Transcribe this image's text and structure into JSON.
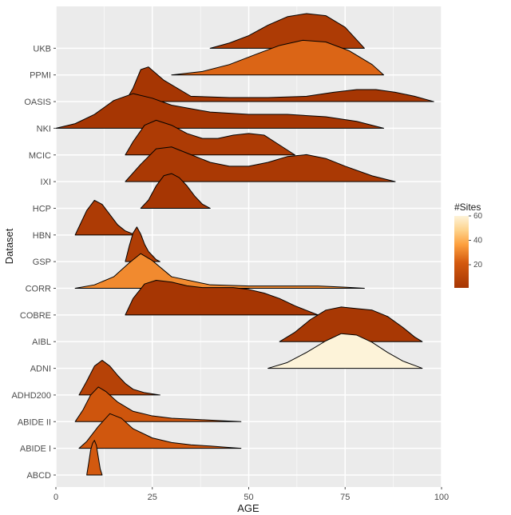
{
  "chart_data": {
    "type": "ridgeline",
    "xlabel": "AGE",
    "ylabel": "Dataset",
    "xlim": [
      0,
      100
    ],
    "x_ticks": [
      0,
      25,
      50,
      75,
      100
    ],
    "legend": {
      "title": "#Sites",
      "min": 1,
      "max": 60,
      "ticks": [
        20,
        40,
        60
      ],
      "low_color": "#a63603",
      "high_color": "#fdf3d9"
    },
    "categories": [
      "UKB",
      "PPMI",
      "OASIS",
      "NKI",
      "MCIC",
      "IXI",
      "HCP",
      "HBN",
      "GSP",
      "CORR",
      "COBRE",
      "AIBL",
      "ADNI",
      "ADHD200",
      "ABIDE II",
      "ABIDE I",
      "ABCD"
    ],
    "series": [
      {
        "name": "UKB",
        "sites": 4,
        "age_range": [
          40,
          80
        ],
        "peak_age": 65,
        "shape": "unimodal-broad",
        "density": [
          [
            40,
            0
          ],
          [
            45,
            5
          ],
          [
            50,
            12
          ],
          [
            55,
            22
          ],
          [
            60,
            30
          ],
          [
            65,
            33
          ],
          [
            70,
            31
          ],
          [
            75,
            20
          ],
          [
            80,
            0
          ]
        ]
      },
      {
        "name": "PPMI",
        "sites": 24,
        "age_range": [
          30,
          85
        ],
        "peak_age": 65,
        "shape": "unimodal-broad-right",
        "density": [
          [
            30,
            0
          ],
          [
            38,
            2
          ],
          [
            45,
            6
          ],
          [
            52,
            12
          ],
          [
            58,
            17
          ],
          [
            64,
            20
          ],
          [
            70,
            19
          ],
          [
            76,
            14
          ],
          [
            82,
            6
          ],
          [
            85,
            0
          ]
        ]
      },
      {
        "name": "OASIS",
        "sites": 1,
        "age_range": [
          18,
          98
        ],
        "peak_age": 23,
        "shape": "bimodal",
        "density": [
          [
            18,
            0
          ],
          [
            20,
            10
          ],
          [
            22,
            24
          ],
          [
            24,
            26
          ],
          [
            28,
            16
          ],
          [
            35,
            4
          ],
          [
            45,
            3
          ],
          [
            55,
            3
          ],
          [
            65,
            4
          ],
          [
            72,
            7
          ],
          [
            78,
            9
          ],
          [
            83,
            9
          ],
          [
            88,
            7
          ],
          [
            93,
            4
          ],
          [
            98,
            0
          ]
        ]
      },
      {
        "name": "NKI",
        "sites": 1,
        "age_range": [
          0,
          85
        ],
        "peak_age": 20,
        "shape": "unimodal-very-wide",
        "density": [
          [
            0,
            0
          ],
          [
            5,
            2
          ],
          [
            10,
            6
          ],
          [
            15,
            12
          ],
          [
            20,
            15
          ],
          [
            25,
            13
          ],
          [
            30,
            10
          ],
          [
            40,
            7
          ],
          [
            50,
            6
          ],
          [
            60,
            6
          ],
          [
            70,
            5
          ],
          [
            78,
            3
          ],
          [
            85,
            0
          ]
        ]
      },
      {
        "name": "MCIC",
        "sites": 4,
        "age_range": [
          18,
          62
        ],
        "peak_age": 25,
        "shape": "bimodal-soft",
        "density": [
          [
            18,
            0
          ],
          [
            20,
            8
          ],
          [
            23,
            18
          ],
          [
            26,
            21
          ],
          [
            30,
            18
          ],
          [
            34,
            13
          ],
          [
            38,
            10
          ],
          [
            42,
            10
          ],
          [
            46,
            12
          ],
          [
            50,
            13
          ],
          [
            54,
            12
          ],
          [
            58,
            6
          ],
          [
            62,
            0
          ]
        ]
      },
      {
        "name": "IXI",
        "sites": 3,
        "age_range": [
          18,
          88
        ],
        "peak_age": 28,
        "shape": "bimodal",
        "density": [
          [
            18,
            0
          ],
          [
            22,
            9
          ],
          [
            26,
            17
          ],
          [
            30,
            18
          ],
          [
            35,
            14
          ],
          [
            40,
            10
          ],
          [
            45,
            8
          ],
          [
            50,
            8
          ],
          [
            55,
            10
          ],
          [
            60,
            13
          ],
          [
            65,
            14
          ],
          [
            70,
            12
          ],
          [
            75,
            8
          ],
          [
            82,
            3
          ],
          [
            88,
            0
          ]
        ]
      },
      {
        "name": "HCP",
        "sites": 1,
        "age_range": [
          22,
          40
        ],
        "peak_age": 29,
        "shape": "unimodal-narrow",
        "density": [
          [
            22,
            0
          ],
          [
            24,
            8
          ],
          [
            26,
            22
          ],
          [
            28,
            32
          ],
          [
            30,
            34
          ],
          [
            32,
            30
          ],
          [
            34,
            22
          ],
          [
            36,
            12
          ],
          [
            38,
            4
          ],
          [
            40,
            0
          ]
        ]
      },
      {
        "name": "HBN",
        "sites": 4,
        "age_range": [
          5,
          22
        ],
        "peak_age": 10,
        "shape": "unimodal-narrow",
        "density": [
          [
            5,
            0
          ],
          [
            6,
            8
          ],
          [
            8,
            24
          ],
          [
            10,
            34
          ],
          [
            12,
            30
          ],
          [
            14,
            20
          ],
          [
            16,
            10
          ],
          [
            18,
            4
          ],
          [
            20,
            1
          ],
          [
            22,
            0
          ]
        ]
      },
      {
        "name": "GSP",
        "sites": 5,
        "age_range": [
          18,
          27
        ],
        "peak_age": 21,
        "shape": "unimodal-sharp",
        "density": [
          [
            18,
            0
          ],
          [
            19,
            15
          ],
          [
            20,
            28
          ],
          [
            21,
            34
          ],
          [
            22,
            27
          ],
          [
            23,
            17
          ],
          [
            24,
            10
          ],
          [
            25,
            6
          ],
          [
            26,
            2
          ],
          [
            27,
            0
          ]
        ]
      },
      {
        "name": "CORR",
        "sites": 32,
        "age_range": [
          5,
          80
        ],
        "peak_age": 22,
        "shape": "right-skewed",
        "density": [
          [
            5,
            0
          ],
          [
            10,
            3
          ],
          [
            15,
            10
          ],
          [
            19,
            22
          ],
          [
            22,
            30
          ],
          [
            25,
            24
          ],
          [
            30,
            10
          ],
          [
            40,
            3
          ],
          [
            50,
            2
          ],
          [
            60,
            2
          ],
          [
            68,
            2
          ],
          [
            75,
            1
          ],
          [
            80,
            0
          ]
        ]
      },
      {
        "name": "COBRE",
        "sites": 1,
        "age_range": [
          18,
          68
        ],
        "peak_age": 25,
        "shape": "bimodal-soft",
        "density": [
          [
            18,
            0
          ],
          [
            20,
            9
          ],
          [
            23,
            17
          ],
          [
            26,
            19
          ],
          [
            30,
            18
          ],
          [
            34,
            16
          ],
          [
            38,
            15
          ],
          [
            42,
            15
          ],
          [
            46,
            15
          ],
          [
            50,
            14
          ],
          [
            54,
            12
          ],
          [
            58,
            9
          ],
          [
            62,
            5
          ],
          [
            68,
            0
          ]
        ]
      },
      {
        "name": "AIBL",
        "sites": 2,
        "age_range": [
          58,
          95
        ],
        "peak_age": 73,
        "shape": "broad-plateau",
        "density": [
          [
            58,
            0
          ],
          [
            62,
            6
          ],
          [
            66,
            14
          ],
          [
            70,
            20
          ],
          [
            74,
            22
          ],
          [
            78,
            21
          ],
          [
            82,
            20
          ],
          [
            86,
            16
          ],
          [
            90,
            9
          ],
          [
            93,
            3
          ],
          [
            95,
            0
          ]
        ]
      },
      {
        "name": "ADNI",
        "sites": 62,
        "age_range": [
          55,
          95
        ],
        "peak_age": 75,
        "shape": "unimodal",
        "density": [
          [
            55,
            0
          ],
          [
            60,
            4
          ],
          [
            65,
            11
          ],
          [
            70,
            19
          ],
          [
            74,
            24
          ],
          [
            78,
            23
          ],
          [
            82,
            18
          ],
          [
            86,
            11
          ],
          [
            90,
            5
          ],
          [
            93,
            2
          ],
          [
            95,
            0
          ]
        ]
      },
      {
        "name": "ADHD200",
        "sites": 8,
        "age_range": [
          6,
          27
        ],
        "peak_age": 12,
        "shape": "unimodal-narrow",
        "density": [
          [
            6,
            0
          ],
          [
            8,
            12
          ],
          [
            10,
            25
          ],
          [
            12,
            30
          ],
          [
            14,
            25
          ],
          [
            16,
            17
          ],
          [
            18,
            10
          ],
          [
            20,
            5
          ],
          [
            23,
            2
          ],
          [
            25,
            1
          ],
          [
            27,
            0
          ]
        ]
      },
      {
        "name": "ABIDE II",
        "sites": 19,
        "age_range": [
          5,
          48
        ],
        "peak_age": 11,
        "shape": "right-skewed",
        "density": [
          [
            5,
            0
          ],
          [
            7,
            10
          ],
          [
            9,
            23
          ],
          [
            11,
            30
          ],
          [
            13,
            26
          ],
          [
            16,
            17
          ],
          [
            20,
            9
          ],
          [
            25,
            5
          ],
          [
            30,
            3
          ],
          [
            36,
            2
          ],
          [
            42,
            1
          ],
          [
            48,
            0
          ]
        ]
      },
      {
        "name": "ABIDE I",
        "sites": 20,
        "age_range": [
          6,
          48
        ],
        "peak_age": 14,
        "shape": "right-skewed",
        "density": [
          [
            6,
            0
          ],
          [
            8,
            6
          ],
          [
            11,
            19
          ],
          [
            14,
            30
          ],
          [
            17,
            26
          ],
          [
            20,
            17
          ],
          [
            25,
            9
          ],
          [
            30,
            5
          ],
          [
            35,
            3
          ],
          [
            40,
            2
          ],
          [
            44,
            1
          ],
          [
            48,
            0
          ]
        ]
      },
      {
        "name": "ABCD",
        "sites": 21,
        "age_range": [
          8,
          12
        ],
        "peak_age": 10,
        "shape": "unimodal-very-narrow",
        "density": [
          [
            8,
            0
          ],
          [
            8.5,
            12
          ],
          [
            9,
            25
          ],
          [
            9.5,
            32
          ],
          [
            10,
            35
          ],
          [
            10.5,
            30
          ],
          [
            11,
            18
          ],
          [
            11.5,
            6
          ],
          [
            12,
            0
          ]
        ]
      }
    ]
  }
}
